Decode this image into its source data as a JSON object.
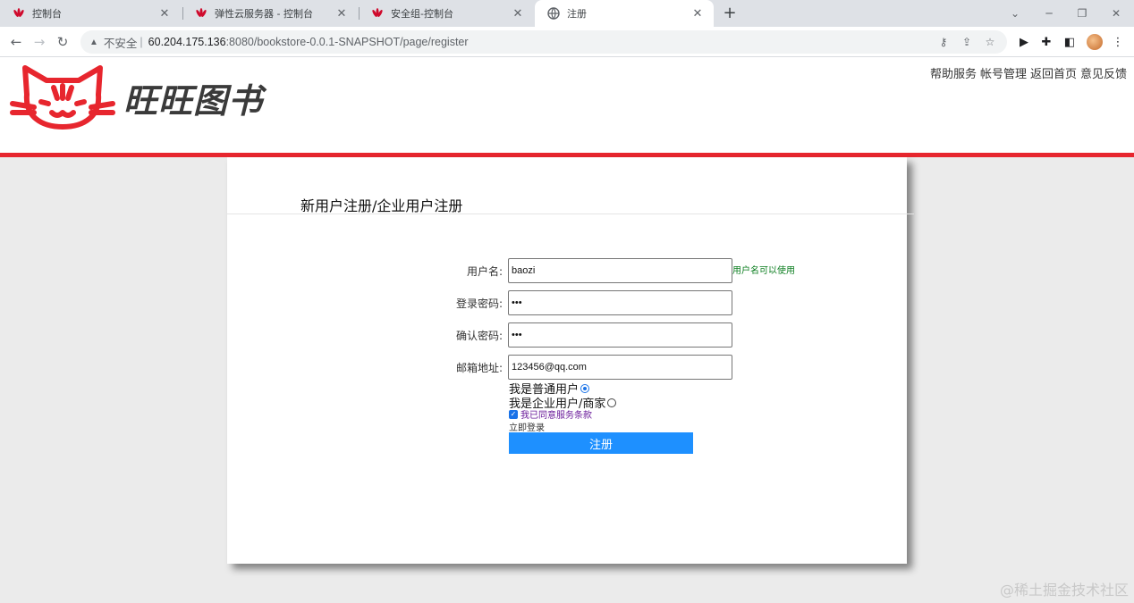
{
  "browser": {
    "tabs": [
      {
        "title": "控制台",
        "favicon": "huawei-cloud-icon",
        "active": false
      },
      {
        "title": "弹性云服务器 - 控制台",
        "favicon": "huawei-cloud-icon",
        "active": false
      },
      {
        "title": "安全组-控制台",
        "favicon": "huawei-cloud-icon",
        "active": false
      },
      {
        "title": "注册",
        "favicon": "globe-icon",
        "active": true
      }
    ],
    "address": {
      "security_label": "不安全",
      "host": "60.204.175.136",
      "port_path": ":8080/bookstore-0.0.1-SNAPSHOT/page/register"
    }
  },
  "site": {
    "brand": "旺旺图书",
    "top_links": [
      "帮助服务",
      "帐号管理",
      "返回首页",
      "意见反馈"
    ],
    "accent_color": "#e7262e"
  },
  "form": {
    "title": "新用户注册/企业用户注册",
    "username": {
      "label": "用户名:",
      "value": "baozi",
      "status": "用户名可以使用"
    },
    "password": {
      "label": "登录密码:",
      "value": "•••"
    },
    "confirm": {
      "label": "确认密码:",
      "value": "•••"
    },
    "email": {
      "label": "邮箱地址:",
      "value": "123456@qq.com"
    },
    "user_types": [
      {
        "label": "我是普通用户",
        "selected": true
      },
      {
        "label": "我是企业用户/商家",
        "selected": false
      }
    ],
    "agree_label": "我已同意服务条款",
    "agree_checked": true,
    "login_link": "立即登录",
    "submit_label": "注册",
    "submit_color": "#1e90ff"
  },
  "watermark": "@稀土掘金技术社区"
}
